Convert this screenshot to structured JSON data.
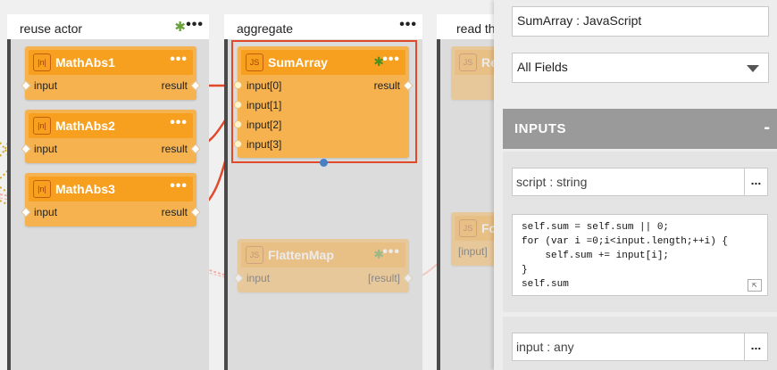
{
  "lanes": [
    {
      "title": "reuse actor"
    },
    {
      "title": "aggregate"
    },
    {
      "title": "read th"
    }
  ],
  "nodes": {
    "mathabs1": {
      "icon": "|n|",
      "title": "MathAbs1",
      "in": "input",
      "out": "result"
    },
    "mathabs2": {
      "icon": "|n|",
      "title": "MathAbs2",
      "in": "input",
      "out": "result"
    },
    "mathabs3": {
      "icon": "|n|",
      "title": "MathAbs3",
      "in": "input",
      "out": "result"
    },
    "sumarray": {
      "icon": "JS",
      "title": "SumArray",
      "inputs": [
        "input[0]",
        "input[1]",
        "input[2]",
        "input[3]"
      ],
      "out": "result"
    },
    "flattenmap": {
      "icon": "JS",
      "title": "FlattenMap",
      "in": "input",
      "out": "[result]"
    },
    "r1": {
      "icon": "JS",
      "title": "Re"
    },
    "r2": {
      "icon": "JS",
      "title": "Fo",
      "in": "[input]"
    }
  },
  "panel": {
    "name_value": "SumArray : JavaScript",
    "filter_value": "All Fields",
    "section_title": "INPUTS",
    "section_toggle": "-",
    "script_field": "script : string",
    "field_menu": "...",
    "input_field": "input : any",
    "code_lines": [
      "self.sum = self.sum || 0;",
      "for (var i =0;i<input.length;++i) {",
      "    self.sum += input[i];",
      "}",
      "self.sum"
    ]
  },
  "icons": {
    "menu": "ellipsis-icon",
    "star": "asterisk-icon",
    "resize": "resize-icon"
  }
}
